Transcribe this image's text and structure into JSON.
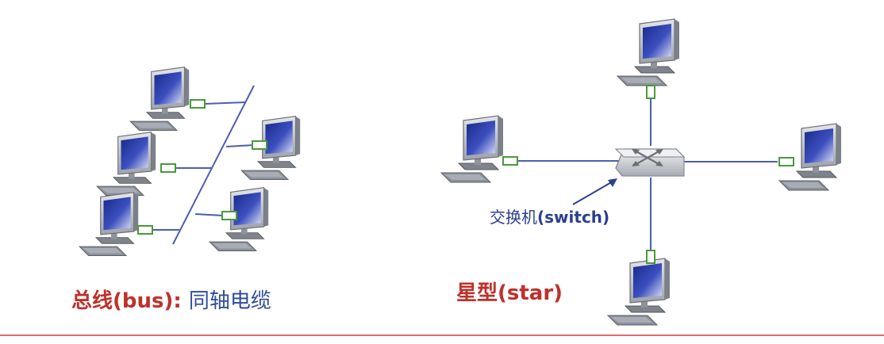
{
  "bus": {
    "caption_prefix": "总线(bus):",
    "caption_suffix": "同轴电缆",
    "caption_prefix_color": "#c0302b",
    "caption_suffix_color": "#2e4a9a"
  },
  "star": {
    "caption": "星型(star)",
    "caption_color": "#c0302b",
    "switch_label_cn": "交换机",
    "switch_label_en": "(switch)",
    "switch_label_color": "#2a3f8f"
  },
  "colors": {
    "link_line": "#4b5fae",
    "nic_green": "#4a9a3a",
    "screen_blue": "#3a45a8",
    "monitor_gray": "#b8bcc4",
    "rule_red": "#e06a6a"
  },
  "icons": {
    "computer": "computer-icon",
    "switch": "switch-icon"
  }
}
